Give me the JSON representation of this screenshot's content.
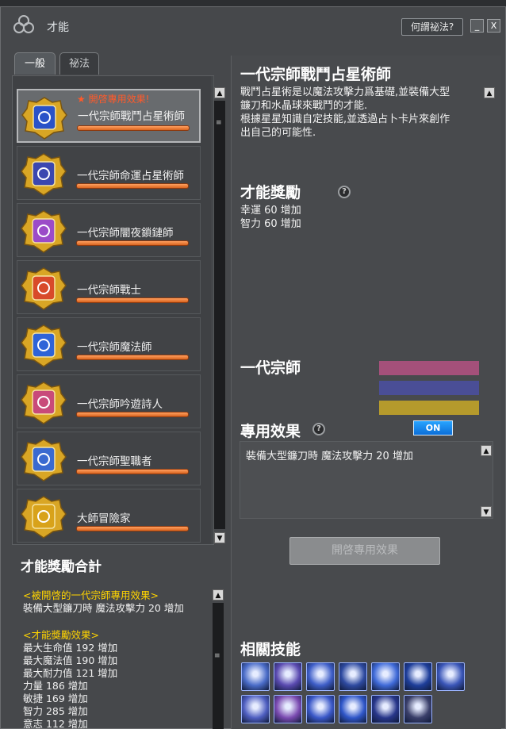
{
  "window": {
    "title": "才能",
    "help_label": "何謂祕法?",
    "minimize_label": "_",
    "close_label": "X"
  },
  "tabs": [
    "一般",
    "祕法"
  ],
  "cards": [
    {
      "name": "一代宗師戰鬥占星術師",
      "tag": "★ 開啓專用效果!",
      "selected": true,
      "icon": "scythe-orb-icon",
      "color": "#2a52c8"
    },
    {
      "name": "一代宗師命運占星術師",
      "tag": "",
      "selected": false,
      "icon": "tarot-cards-icon",
      "color": "#3b47b0"
    },
    {
      "name": "一代宗師闇夜鎖鏈師",
      "tag": "",
      "selected": false,
      "icon": "chain-icon",
      "color": "#9b4bc8"
    },
    {
      "name": "一代宗師戰士",
      "tag": "",
      "selected": false,
      "icon": "sword-icon",
      "color": "#d84a2a"
    },
    {
      "name": "一代宗師魔法師",
      "tag": "",
      "selected": false,
      "icon": "hexagram-icon",
      "color": "#2e63d8"
    },
    {
      "name": "一代宗師吟遊詩人",
      "tag": "",
      "selected": false,
      "icon": "lute-icon",
      "color": "#c84a7a"
    },
    {
      "name": "一代宗師聖職者",
      "tag": "",
      "selected": false,
      "icon": "winged-heart-icon",
      "color": "#3a6ad0"
    },
    {
      "name": "大師冒險家",
      "tag": "",
      "selected": false,
      "icon": "compass-icon",
      "color": "#d8a21a"
    }
  ],
  "summary": {
    "title": "才能獎勵合計",
    "special_label": "<被開啓的一代宗師專用效果>",
    "special_line": "裝備大型鐮刀時 魔法攻擊力 20 增加",
    "bonus_label": "<才能獎勵效果>",
    "bonus_lines": [
      "最大生命值 192 增加",
      "最大魔法值 190 增加",
      "最大耐力值 121 增加",
      "力量 186 增加",
      "敏捷 169 增加",
      "智力 285 增加",
      "意志 112 增加"
    ]
  },
  "detail": {
    "title": "一代宗師戰鬥占星術師",
    "description": [
      "戰鬥占星術是以魔法攻擊力爲基礎,並裝備大型",
      "鐮刀和水晶球來戰鬥的才能.",
      "根據星星知識自定技能,並透過占卜卡片來創作",
      "出自己的可能性."
    ],
    "reward_title": "才能獎勵",
    "reward_lines": [
      "幸運 60 增加",
      "智力 60 增加"
    ],
    "grandmaster_title": "一代宗師",
    "bar_colors": [
      "#a4507a",
      "#4a4e96",
      "#b59a2c"
    ],
    "special_title": "專用效果",
    "toggle_label": "ON",
    "special_effect": "裝備大型鐮刀時 魔法攻擊力 20 增加",
    "open_button": "開啓專用效果",
    "skills_title": "相關技能",
    "skills": [
      {
        "icon": "scythe-slash-icon",
        "color": "#4a6cc8"
      },
      {
        "icon": "sunrise-icon",
        "color": "#5a4ab0"
      },
      {
        "icon": "crescent-slash-icon",
        "color": "#3e5ec8"
      },
      {
        "icon": "crossed-scythes-icon",
        "color": "#2e4aa0"
      },
      {
        "icon": "vortex-icon",
        "color": "#3f6ad8"
      },
      {
        "icon": "light-pillars-icon",
        "color": "#1e3e9a"
      },
      {
        "icon": "star-burst-icon",
        "color": "#3a56b8"
      },
      {
        "icon": "planet-rings-icon",
        "color": "#4e5ec0"
      },
      {
        "icon": "sparkle-star-icon",
        "color": "#7a4ab0"
      },
      {
        "icon": "radiant-star-icon",
        "color": "#3a58c8"
      },
      {
        "icon": "zodiac-circle-icon",
        "color": "#2f56c8"
      },
      {
        "icon": "tarot-card-icon",
        "color": "#27368a"
      },
      {
        "icon": "statue-icon",
        "color": "#3a3f6a"
      }
    ]
  }
}
